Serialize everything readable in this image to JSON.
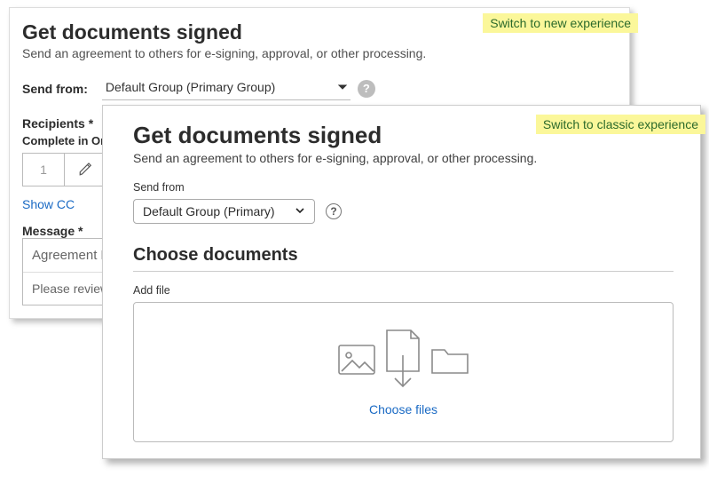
{
  "classic": {
    "title": "Get documents signed",
    "subtitle": "Send an agreement to others for e-signing, approval, or other processing.",
    "switch_label": "Switch to new experience",
    "send_from_label": "Send from:",
    "send_from_value": "Default Group (Primary Group)",
    "recipients_label": "Recipients *",
    "complete_order_label": "Complete in Ord",
    "order_number": "1",
    "show_cc": "Show CC",
    "message_label": "Message *",
    "agreement_name": "Agreement N",
    "review_text": "Please review a"
  },
  "newexp": {
    "title": "Get documents signed",
    "subtitle": "Send an agreement to others for e-signing, approval, or other processing.",
    "switch_label": "Switch to classic experience",
    "send_from_label": "Send from",
    "send_from_value": "Default Group (Primary)",
    "choose_docs_heading": "Choose documents",
    "add_file_label": "Add file",
    "choose_files": "Choose files"
  }
}
